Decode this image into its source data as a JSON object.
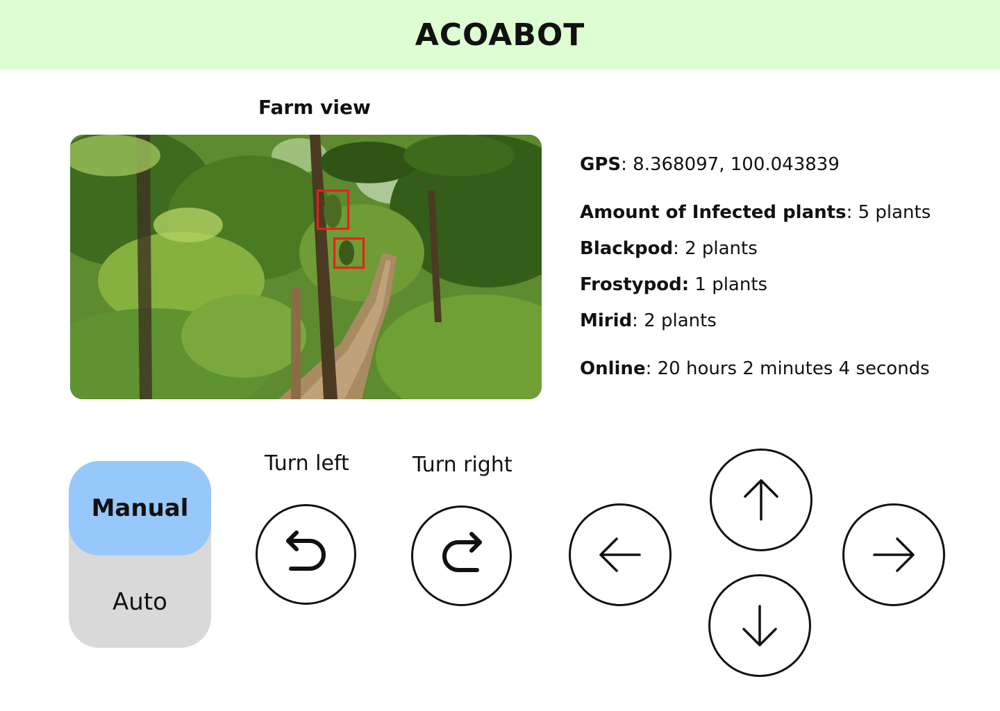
{
  "header": {
    "title": "ACOABOT",
    "background": "#ddfdd2"
  },
  "farm_view": {
    "label": "Farm view",
    "detection_color": "#ee1c1c"
  },
  "status": {
    "gps": {
      "label": "GPS",
      "value": "8.368097, 100.043839"
    },
    "infected": {
      "label": "Amount of Infected plants",
      "value": "5 plants"
    },
    "blackpod": {
      "label": "Blackpod",
      "value": "2 plants"
    },
    "frostypod": {
      "label": "Frostypod:",
      "value": "1 plants"
    },
    "mirid": {
      "label": "Mirid",
      "value": "2 plants"
    },
    "online": {
      "label": "Online",
      "value": "20 hours 2 minutes 4 seconds"
    }
  },
  "mode": {
    "selected": "Manual",
    "manual_label": "Manual",
    "auto_label": "Auto",
    "active_color": "#97c8fb",
    "inactive_color": "#d9d9d9"
  },
  "controls": {
    "turn_left_label": "Turn left",
    "turn_right_label": "Turn right",
    "icons": [
      "turn-left-icon",
      "turn-right-icon",
      "arrow-left-icon",
      "arrow-up-icon",
      "arrow-down-icon",
      "arrow-right-icon"
    ]
  }
}
